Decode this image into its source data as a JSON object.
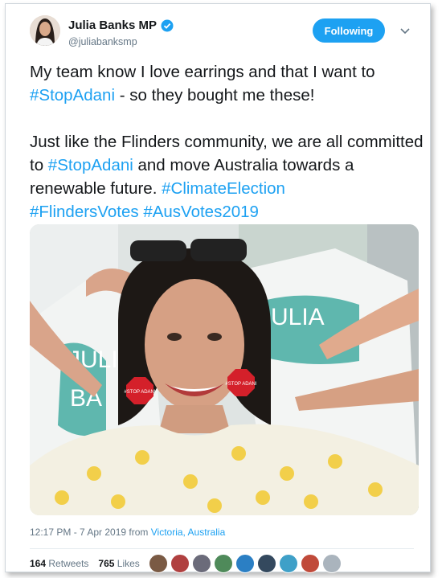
{
  "header": {
    "display_name": "Julia Banks MP",
    "handle": "@juliabanksmp",
    "follow_label": "Following"
  },
  "tweet": {
    "para1_pre": "My team know I love earrings and that I want to ",
    "tag1": "#StopAdani",
    "para1_post": " - so they bought me these!",
    "para2_pre": "Just like the Flinders community, we are all committed to ",
    "tag2": "#StopAdani",
    "para2_mid": " and move Australia towards a renewable future. ",
    "tag3": "#ClimateElection",
    "tag4": "#FlindersVotes",
    "tag5": "#AusVotes2019"
  },
  "photo": {
    "shirt_text_1": "JULIA",
    "shirt_text_2": "BA",
    "shirt_text_3": "JULIA",
    "earring_text": "#STOP ADANI"
  },
  "meta": {
    "timestamp": "12:17 PM - 7 Apr 2019 from ",
    "location": "Victoria, Australia"
  },
  "stats": {
    "retweets_count": "164",
    "retweets_label": "Retweets",
    "likes_count": "765",
    "likes_label": "Likes"
  },
  "colors": {
    "accent": "#1da1f2",
    "text": "#14171a",
    "muted": "#657786"
  },
  "liker_colors": [
    "#7a5a44",
    "#b04040",
    "#6b6b7a",
    "#4f8a5a",
    "#2b7fc4",
    "#34495e",
    "#3fa0c8",
    "#c04a3a",
    "#aab4bd"
  ]
}
